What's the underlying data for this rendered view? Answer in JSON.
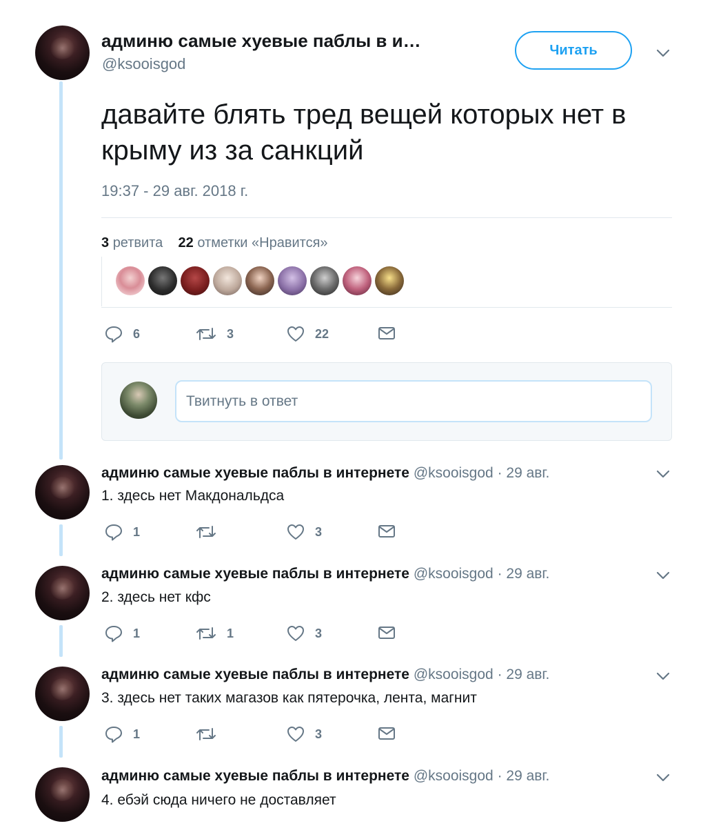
{
  "main_tweet": {
    "author_name": "админю самые хуевые паблы в и…",
    "handle": "@ksooisgod",
    "follow_label": "Читать",
    "text": "давайте блять тред вещей которых нет в крыму из за санкций",
    "timestamp": "19:37 - 29 авг. 2018 г.",
    "retweets_count": "3",
    "retweets_label": "ретвита",
    "likes_count": "22",
    "likes_label": "отметки «Нравится»",
    "actions": {
      "reply": "6",
      "retweet": "3",
      "like": "22"
    }
  },
  "reply_composer": {
    "placeholder": "Твитнуть в ответ"
  },
  "replies": [
    {
      "name": "админю самые хуевые паблы в интернете",
      "handle": "@ksooisgod",
      "date": "· 29 авг.",
      "text": "1. здесь нет Макдональдса",
      "reply": "1",
      "retweet": "",
      "like": "3"
    },
    {
      "name": "админю самые хуевые паблы в интернете",
      "handle": "@ksooisgod",
      "date": "· 29 авг.",
      "text": "2. здесь нет кфс",
      "reply": "1",
      "retweet": "1",
      "like": "3"
    },
    {
      "name": "админю самые хуевые паблы в интернете",
      "handle": "@ksooisgod",
      "date": "· 29 авг.",
      "text": "3. здесь нет таких магазов как пятерочка, лента, магнит",
      "reply": "1",
      "retweet": "",
      "like": "3"
    },
    {
      "name": "админю самые хуевые паблы в интернете",
      "handle": "@ksooisgod",
      "date": "· 29 авг.",
      "text": "4. ебэй сюда ничего не доставляет"
    }
  ],
  "icons": {
    "reply": "reply-icon",
    "retweet": "retweet-icon",
    "like": "heart-icon",
    "message": "envelope-icon",
    "more": "chevron-down-icon"
  },
  "colors": {
    "accent": "#1da1f2",
    "thread_line": "#c4e3f9",
    "muted": "#657786"
  }
}
